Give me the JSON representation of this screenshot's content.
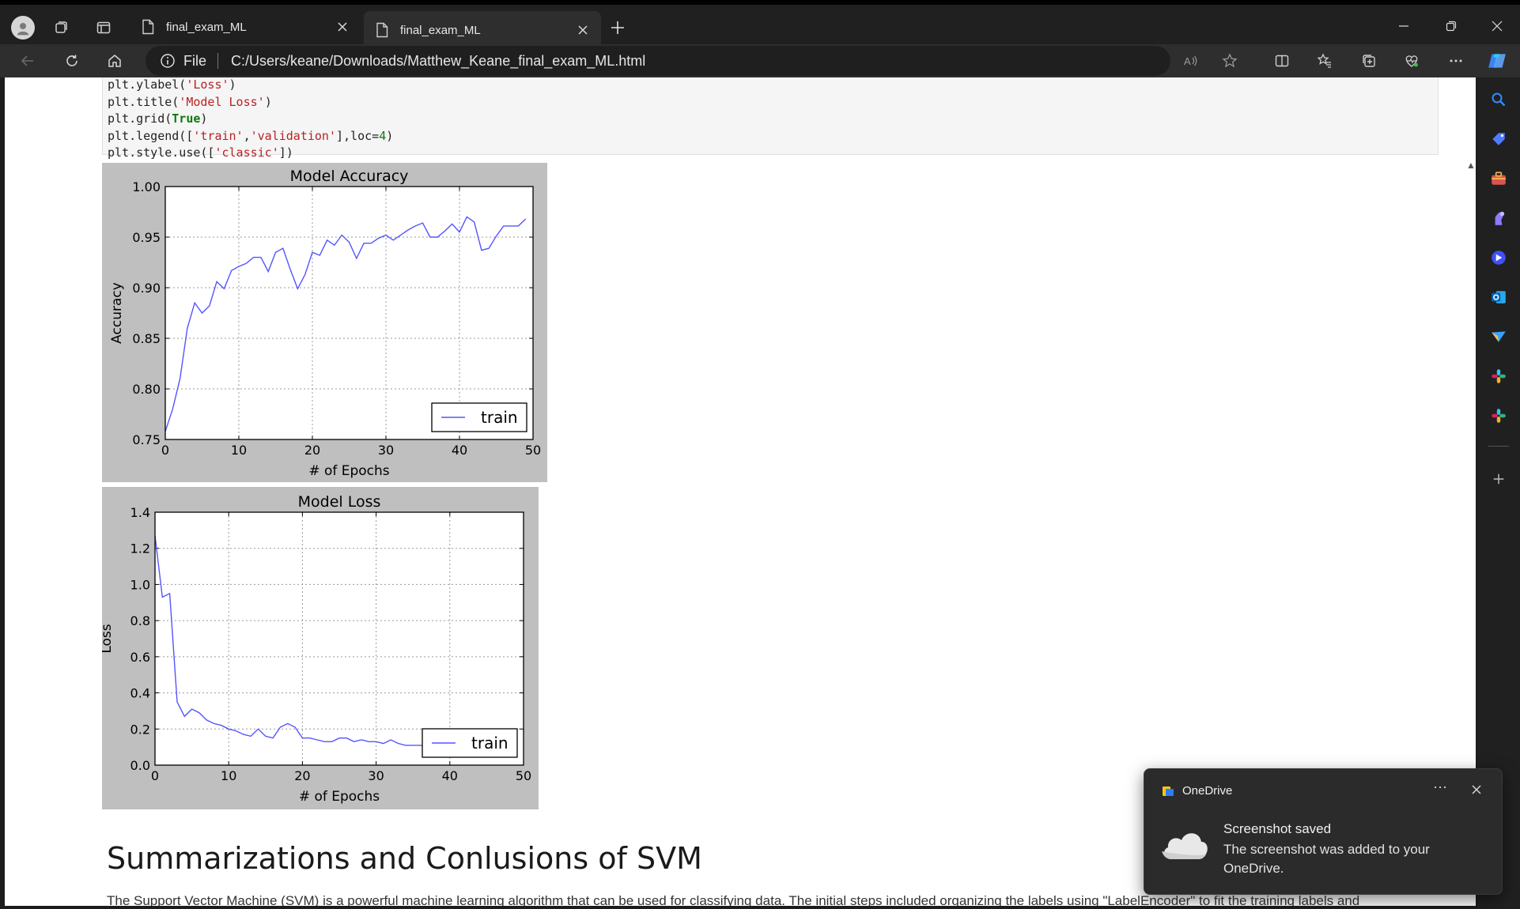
{
  "browser": {
    "tabs": [
      {
        "title": "final_exam_ML",
        "active": false
      },
      {
        "title": "final_exam_ML",
        "active": true
      }
    ],
    "address": {
      "scheme_label": "File",
      "url": "C:/Users/keane/Downloads/Matthew_Keane_final_exam_ML.html"
    }
  },
  "code_cell": {
    "lines": [
      "plt.ylabel('Loss')",
      "plt.title('Model Loss')",
      "plt.grid(True)",
      "plt.legend(['train','validation'],loc=4)",
      "plt.style.use(['classic'])"
    ]
  },
  "chart_data": [
    {
      "type": "line",
      "title": "Model Accuracy",
      "xlabel": "# of Epochs",
      "ylabel": "Accuracy",
      "xlim": [
        0,
        50
      ],
      "ylim": [
        0.75,
        1.0
      ],
      "xticks": [
        0,
        10,
        20,
        30,
        40,
        50
      ],
      "yticks": [
        0.75,
        0.8,
        0.85,
        0.9,
        0.95,
        1.0
      ],
      "ytick_labels": [
        "0.75",
        "0.80",
        "0.85",
        "0.90",
        "0.95",
        "1.00"
      ],
      "grid": true,
      "legend_position": "lower-right",
      "series": [
        {
          "name": "train",
          "color": "#5555ff",
          "x": [
            0,
            1,
            2,
            3,
            4,
            5,
            6,
            7,
            8,
            9,
            10,
            11,
            12,
            13,
            14,
            15,
            16,
            17,
            18,
            19,
            20,
            21,
            22,
            23,
            24,
            25,
            26,
            27,
            28,
            29,
            30,
            31,
            32,
            33,
            34,
            35,
            36,
            37,
            38,
            39,
            40,
            41,
            42,
            43,
            44,
            45,
            46,
            47,
            48,
            49
          ],
          "values": [
            0.758,
            0.78,
            0.81,
            0.86,
            0.885,
            0.875,
            0.882,
            0.906,
            0.899,
            0.917,
            0.921,
            0.924,
            0.93,
            0.93,
            0.916,
            0.935,
            0.939,
            0.918,
            0.899,
            0.913,
            0.935,
            0.932,
            0.947,
            0.942,
            0.952,
            0.945,
            0.929,
            0.944,
            0.944,
            0.949,
            0.952,
            0.947,
            0.952,
            0.957,
            0.961,
            0.964,
            0.95,
            0.95,
            0.956,
            0.963,
            0.955,
            0.97,
            0.965,
            0.937,
            0.939,
            0.951,
            0.961,
            0.961,
            0.961,
            0.968
          ]
        }
      ]
    },
    {
      "type": "line",
      "title": "Model Loss",
      "xlabel": "# of Epochs",
      "ylabel": "Loss",
      "xlim": [
        0,
        50
      ],
      "ylim": [
        0.0,
        1.4
      ],
      "xticks": [
        0,
        10,
        20,
        30,
        40,
        50
      ],
      "yticks": [
        0.0,
        0.2,
        0.4,
        0.6,
        0.8,
        1.0,
        1.2,
        1.4
      ],
      "ytick_labels": [
        "0.0",
        "0.2",
        "0.4",
        "0.6",
        "0.8",
        "1.0",
        "1.2",
        "1.4"
      ],
      "grid": true,
      "legend_position": "lower-right",
      "series": [
        {
          "name": "train",
          "color": "#5555ff",
          "x": [
            0,
            1,
            2,
            3,
            4,
            5,
            6,
            7,
            8,
            9,
            10,
            11,
            12,
            13,
            14,
            15,
            16,
            17,
            18,
            19,
            20,
            21,
            22,
            23,
            24,
            25,
            26,
            27,
            28,
            29,
            30,
            31,
            32,
            33,
            34,
            35,
            36,
            37,
            38,
            39,
            40,
            41,
            42,
            43,
            44,
            45,
            46,
            47,
            48,
            49
          ],
          "values": [
            1.27,
            0.93,
            0.95,
            0.35,
            0.27,
            0.31,
            0.29,
            0.25,
            0.23,
            0.22,
            0.2,
            0.19,
            0.17,
            0.16,
            0.2,
            0.16,
            0.15,
            0.21,
            0.23,
            0.21,
            0.15,
            0.15,
            0.14,
            0.13,
            0.13,
            0.15,
            0.15,
            0.13,
            0.14,
            0.13,
            0.13,
            0.12,
            0.14,
            0.12,
            0.11,
            0.11,
            0.11,
            0.1,
            0.1,
            0.1,
            0.1,
            0.1,
            0.1,
            0.1,
            0.1,
            0.1,
            0.1,
            0.1,
            0.1,
            0.1
          ]
        }
      ]
    }
  ],
  "section": {
    "heading": "Summarizations and Conlusions of SVM",
    "paragraph_start": "The Support Vector Machine (SVM) is a powerful machine learning algorithm that can be used for classifying data. The initial steps included organizing the labels using \"LabelEncoder\" to fit the training labels and"
  },
  "toast": {
    "app_name": "OneDrive",
    "title": "Screenshot saved",
    "body": "The screenshot was added to your OneDrive."
  }
}
